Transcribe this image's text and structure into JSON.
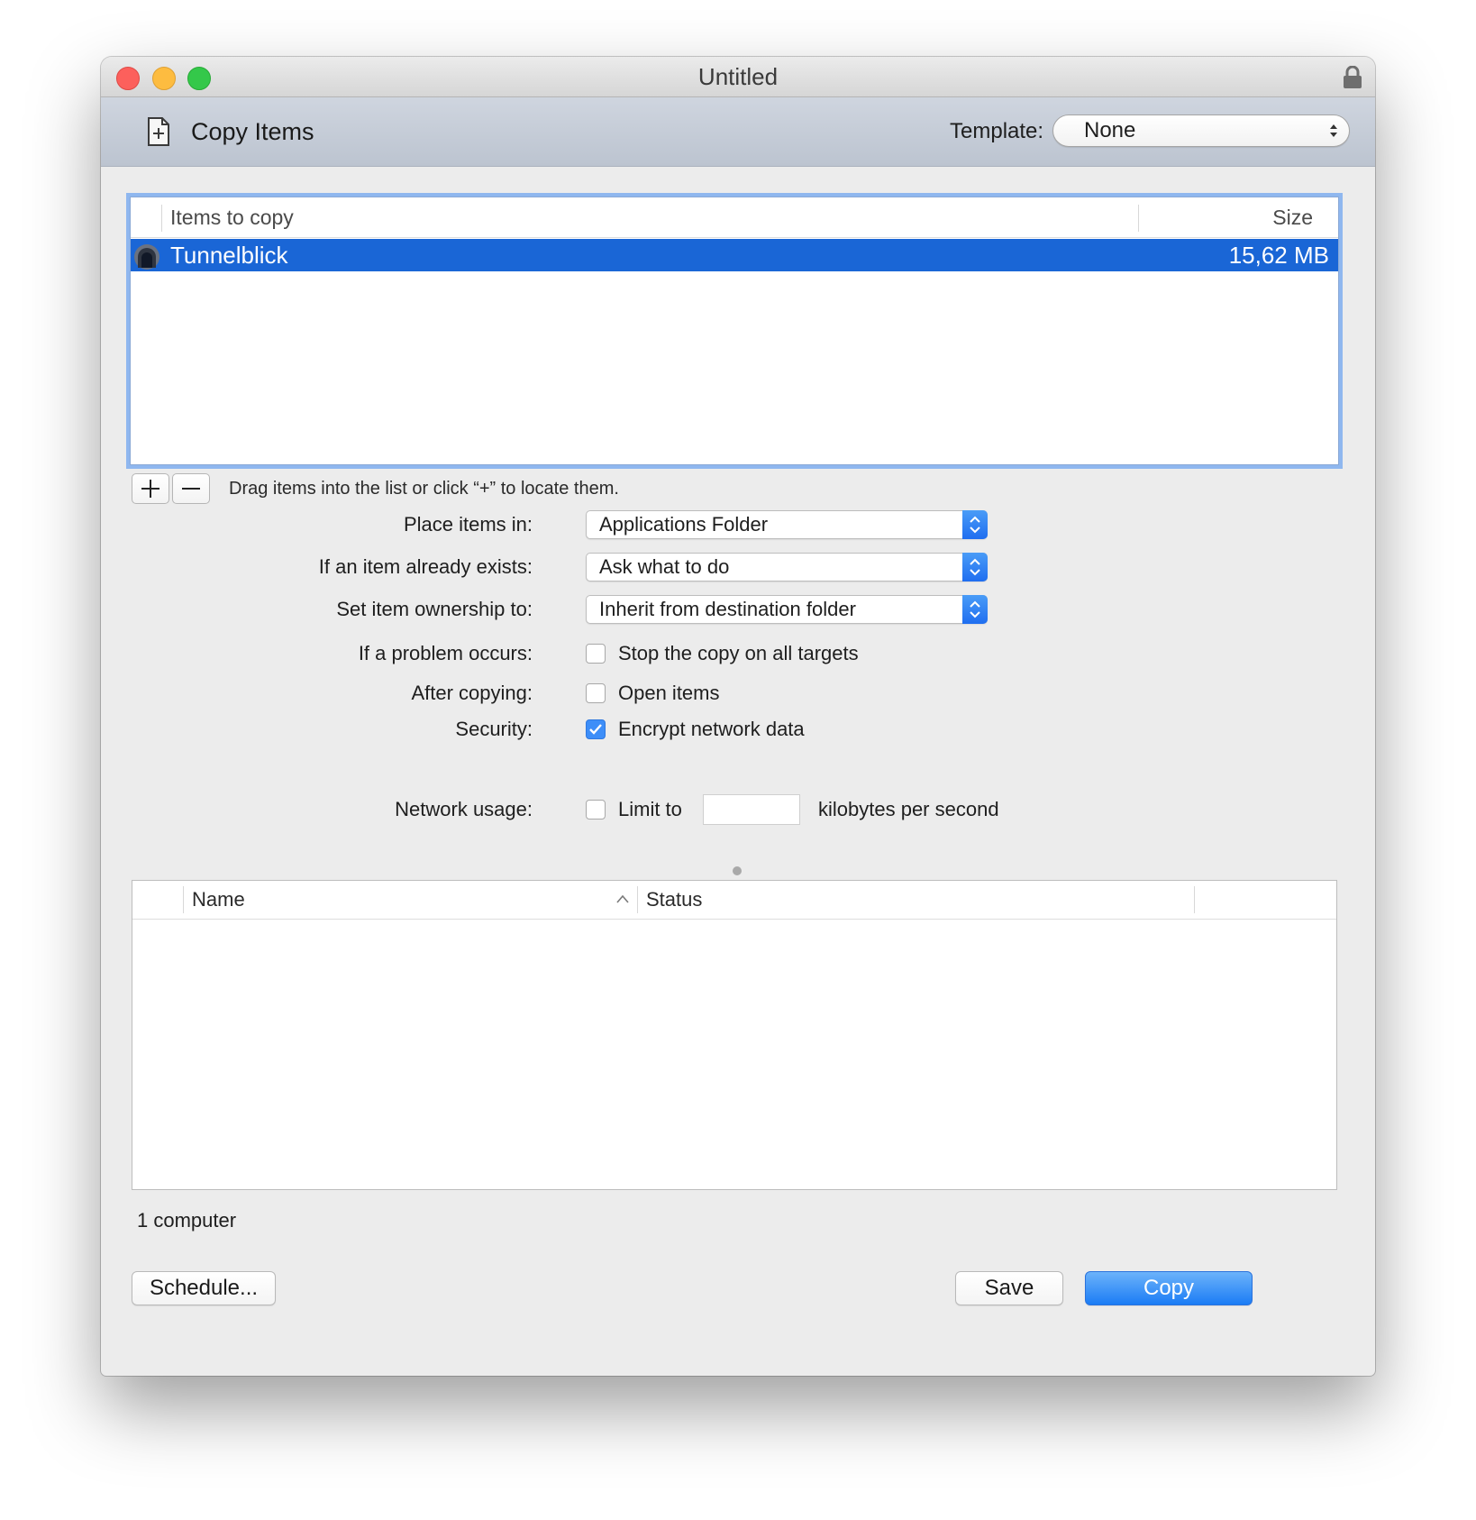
{
  "window": {
    "title": "Untitled"
  },
  "toolbar": {
    "title": "Copy Items",
    "template_label": "Template:",
    "template_value": "None"
  },
  "items_list": {
    "columns": [
      "Items to copy",
      "Size"
    ],
    "rows": [
      {
        "name": "Tunnelblick",
        "size": "15,62 MB",
        "selected": true
      }
    ]
  },
  "items_hint": "Drag items into the list or click “+” to locate them.",
  "options": {
    "place_items_label": "Place items in:",
    "place_items_value": "Applications Folder",
    "exists_label": "If an item already exists:",
    "exists_value": "Ask what to do",
    "ownership_label": "Set item ownership to:",
    "ownership_value": "Inherit from destination folder",
    "problem_label": "If a problem occurs:",
    "problem_checkbox_label": "Stop the copy on all targets",
    "problem_checked": false,
    "after_label": "After copying:",
    "after_checkbox_label": "Open items",
    "after_checked": false,
    "security_label": "Security:",
    "security_checkbox_label": "Encrypt network data",
    "security_checked": true,
    "network_label": "Network usage:",
    "network_checkbox_label": "Limit to",
    "network_checked": false,
    "network_limit_value": "",
    "network_unit_label": "kilobytes per second"
  },
  "status_table": {
    "columns": [
      "Name",
      "Status"
    ],
    "sorted_by": "Name",
    "rows": []
  },
  "computer_count": "1 computer",
  "buttons": {
    "schedule": "Schedule...",
    "save": "Save",
    "copy": "Copy"
  },
  "colors": {
    "accent": "#1a66d6",
    "primary_button": "#1b7cf5",
    "checkbox_checked": "#3d8ef8"
  },
  "icons": [
    "close-button",
    "minimize-button",
    "zoom-button",
    "lock-icon",
    "document-add-icon",
    "updown-arrows-icon",
    "tunnelblick-app-icon",
    "plus-icon",
    "minus-icon",
    "checkmark-icon",
    "sort-ascending-icon"
  ]
}
